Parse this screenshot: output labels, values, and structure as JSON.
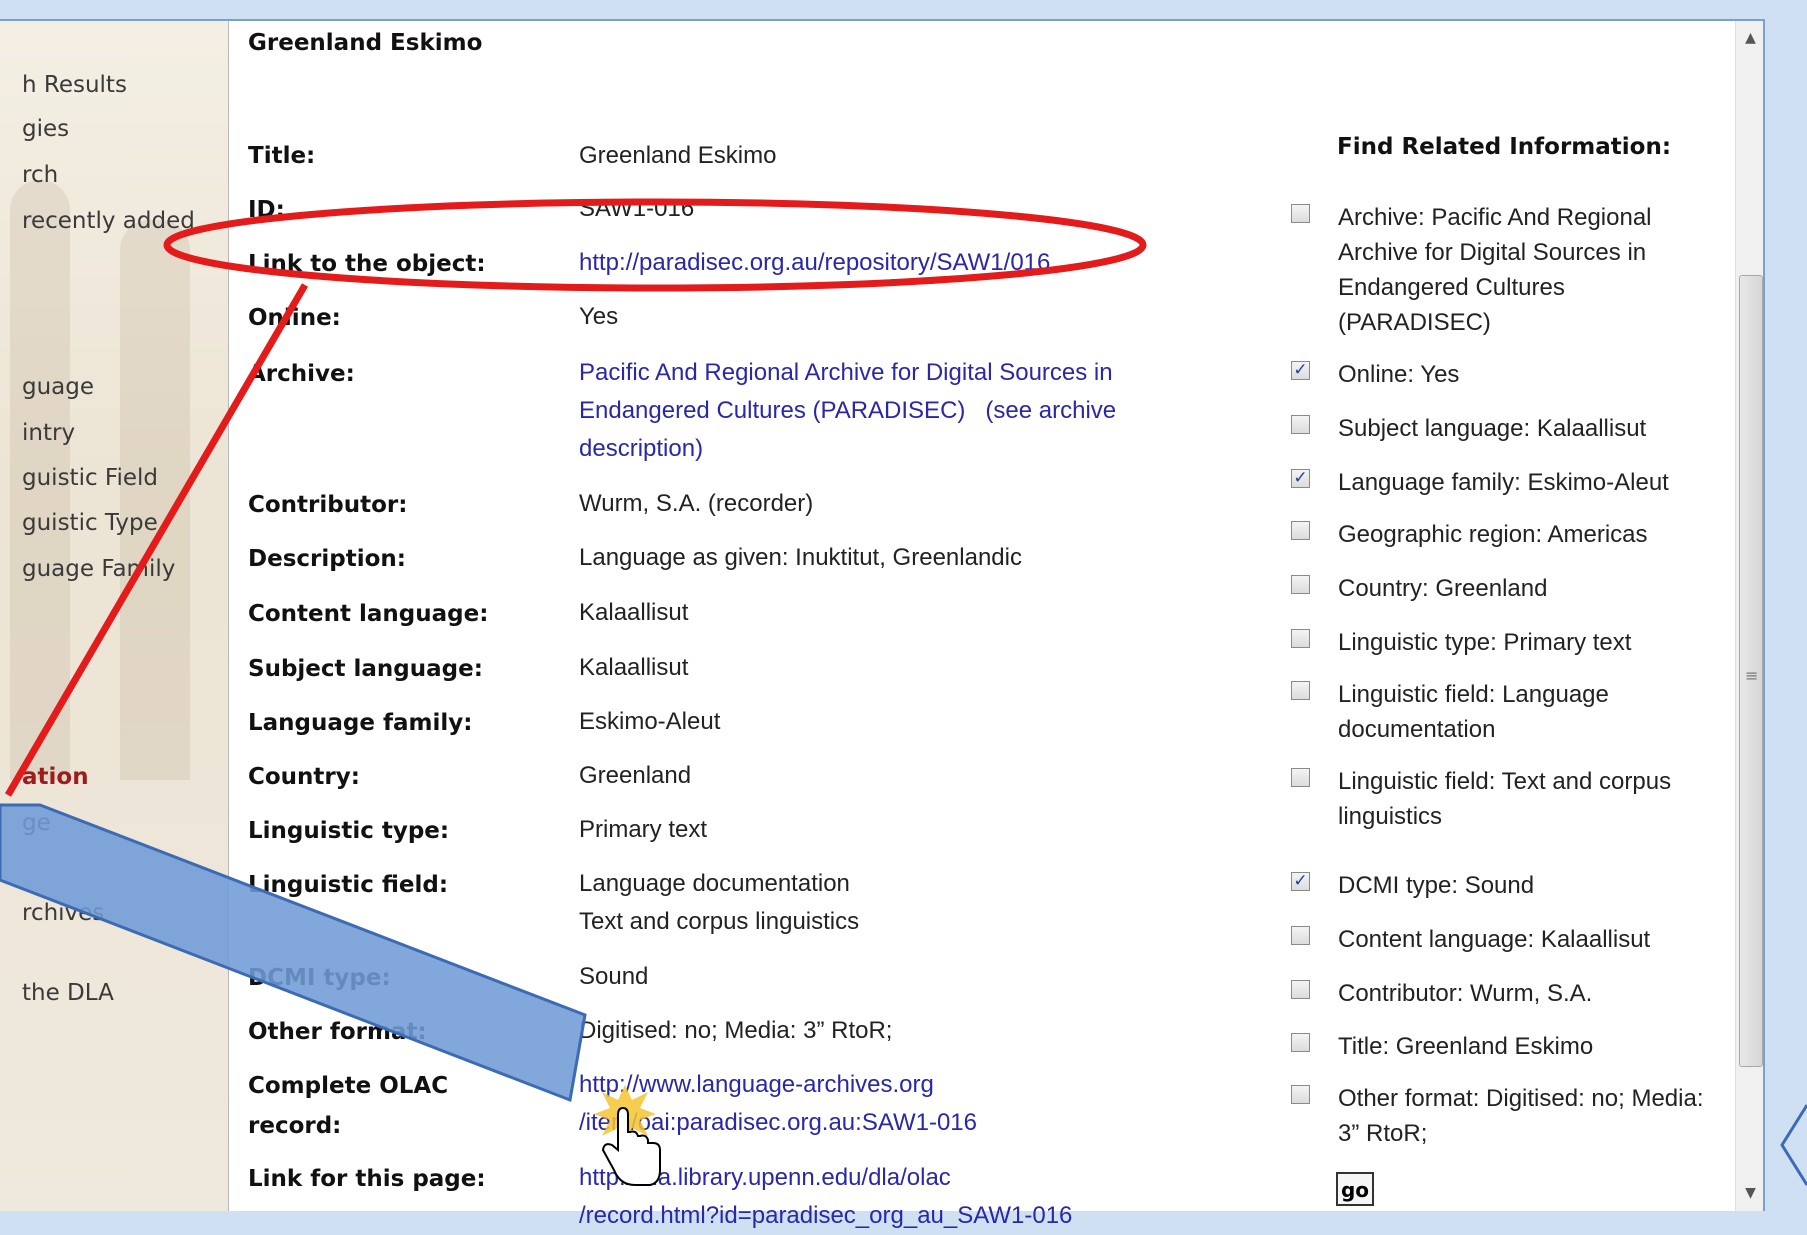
{
  "sidebar": {
    "items": [
      "h Results",
      "gies",
      "rch",
      "recently added",
      "guage",
      "intry",
      "guistic Field",
      "guistic Type",
      "guage Family",
      "ation",
      "ge",
      "rchives",
      "the DLA"
    ]
  },
  "record": {
    "page_title": "Greenland Eskimo",
    "fields": [
      {
        "label": "Title:",
        "value": "Greenland Eskimo"
      },
      {
        "label": "ID:",
        "value": "SAW1-016"
      },
      {
        "label": "Link to the object:",
        "value": "http://paradisec.org.au/repository/SAW1/016"
      },
      {
        "label": "Online:",
        "value": "Yes"
      },
      {
        "label": "Archive:",
        "value": "Pacific And Regional Archive for Digital Sources in Endangered Cultures (PARADISEC)",
        "extra": "(see archive description)"
      },
      {
        "label": "Contributor:",
        "value": "Wurm, S.A. (recorder)"
      },
      {
        "label": "Description:",
        "value": "Language as given: Inuktitut, Greenlandic"
      },
      {
        "label": "Content language:",
        "value": "Kalaallisut"
      },
      {
        "label": "Subject language:",
        "value": "Kalaallisut"
      },
      {
        "label": "Language family:",
        "value": "Eskimo-Aleut"
      },
      {
        "label": "Country:",
        "value": "Greenland"
      },
      {
        "label": "Linguistic type:",
        "value": "Primary text"
      },
      {
        "label": "Linguistic field:",
        "value": "Language documentation",
        "value2": "Text and corpus linguistics"
      },
      {
        "label": "DCMI type:",
        "value": "Sound"
      },
      {
        "label": "Other format:",
        "value": "Digitised: no; Media: 3” RtoR;"
      },
      {
        "label": "Complete OLAC",
        "label2": "record:",
        "value": "http://www.language-archives.org",
        "value2": "/item/oai:paradisec.org.au:SAW1-016"
      },
      {
        "label": "Link for this page:",
        "value": "http://dla.library.upenn.edu/dla/olac",
        "value2": "/record.html?id=paradisec_org_au_SAW1-016"
      }
    ]
  },
  "related": {
    "title": "Find Related Information:",
    "items": [
      {
        "text": "Archive: Pacific And Regional Archive for Digital Sources in Endangered Cultures (PARADISEC)",
        "checked": false
      },
      {
        "text": "Online: Yes",
        "checked": true
      },
      {
        "text": "Subject language: Kalaallisut",
        "checked": false
      },
      {
        "text": "Language family: Eskimo-Aleut",
        "checked": true
      },
      {
        "text": "Geographic region: Americas",
        "checked": false
      },
      {
        "text": "Country: Greenland",
        "checked": false
      },
      {
        "text": "Linguistic type: Primary text",
        "checked": false
      },
      {
        "text": "Linguistic field: Language documentation",
        "checked": false
      },
      {
        "text": "Linguistic field: Text and corpus linguistics",
        "checked": false
      },
      {
        "text": "DCMI type: Sound",
        "checked": true
      },
      {
        "text": "Content language: Kalaallisut",
        "checked": false
      },
      {
        "text": "Contributor: Wurm, S.A.",
        "checked": false
      },
      {
        "text": "Title: Greenland Eskimo",
        "checked": false
      },
      {
        "text": "Other format: Digitised: no; Media: 3” RtoR;",
        "checked": false
      }
    ],
    "go_label": "go"
  },
  "colors": {
    "link": "#2828a8",
    "annotation_red": "#e31b1b",
    "callout_fill": "#6f9bd6",
    "callout_stroke": "#3d6bb3",
    "sidebar_active": "#9b1d1d"
  },
  "icons": {
    "scroll_up": "up-arrow-icon",
    "scroll_down": "down-arrow-icon",
    "cursor": "hand-pointer-icon",
    "check": "checkmark-icon"
  }
}
